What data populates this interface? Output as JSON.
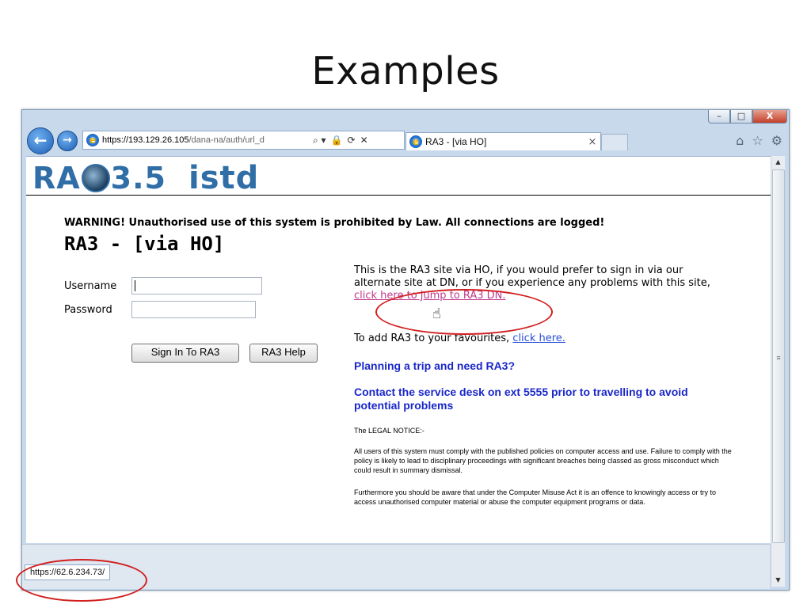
{
  "slide": {
    "title": "Examples"
  },
  "window": {
    "minimize": "–",
    "maximize": "□",
    "close": "X"
  },
  "browser": {
    "back": "←",
    "forward": "→",
    "url_host": "https://193.129.26.105",
    "url_path": "/dana-na/auth/url_d",
    "addr_icons": [
      "⌕ ▾",
      "🔒",
      "⟳",
      "✕"
    ],
    "tab_title": "RA3 - [via HO]",
    "tab_close": "×",
    "home": "⌂",
    "favorites": "☆",
    "tools": "⚙"
  },
  "page": {
    "logo_ra": "RA",
    "logo_version": "3.5",
    "logo_istd": "istd",
    "warning": "WARNING! Unauthorised use of this system is prohibited by Law. All connections are logged!",
    "title": "RA3 - [via HO]",
    "username_label": "Username",
    "password_label": "Password",
    "sign_in_button": "Sign In To RA3",
    "help_button": "RA3 Help",
    "info_text_before": "This is the RA3 site via HO, if you would prefer to sign in via our alternate site at DN, or if you experience any problems with this site, ",
    "jump_link": "click here to jump to RA3 DN.",
    "favourites_text": "To add RA3 to your favourites, ",
    "favourites_link": "click here.",
    "planning": "Planning a trip and need RA3?",
    "contact": "Contact the service desk on ext 5555 prior to travelling to avoid potential problems",
    "legal_heading": "The LEGAL NOTICE:-",
    "legal_p1": "All users of this system must comply with the published policies on computer access and use. Failure to comply with the policy is likely to lead to disciplinary proceedings with significant breaches being classed as gross misconduct which could result in summary dismissal.",
    "legal_p2": "Furthermore you should be aware that under the Computer Misuse Act it is an offence to knowingly access or try to access unauthorised computer material or abuse the computer equipment programs or data."
  },
  "status": {
    "url": "https://62.6.234.73/"
  },
  "scrollbar": {
    "up": "▲",
    "down": "▼",
    "grip": "≡"
  },
  "colors": {
    "annotation": "#d21f1f",
    "logo": "#2f6ea6",
    "notice_blue": "#1a27c9"
  }
}
